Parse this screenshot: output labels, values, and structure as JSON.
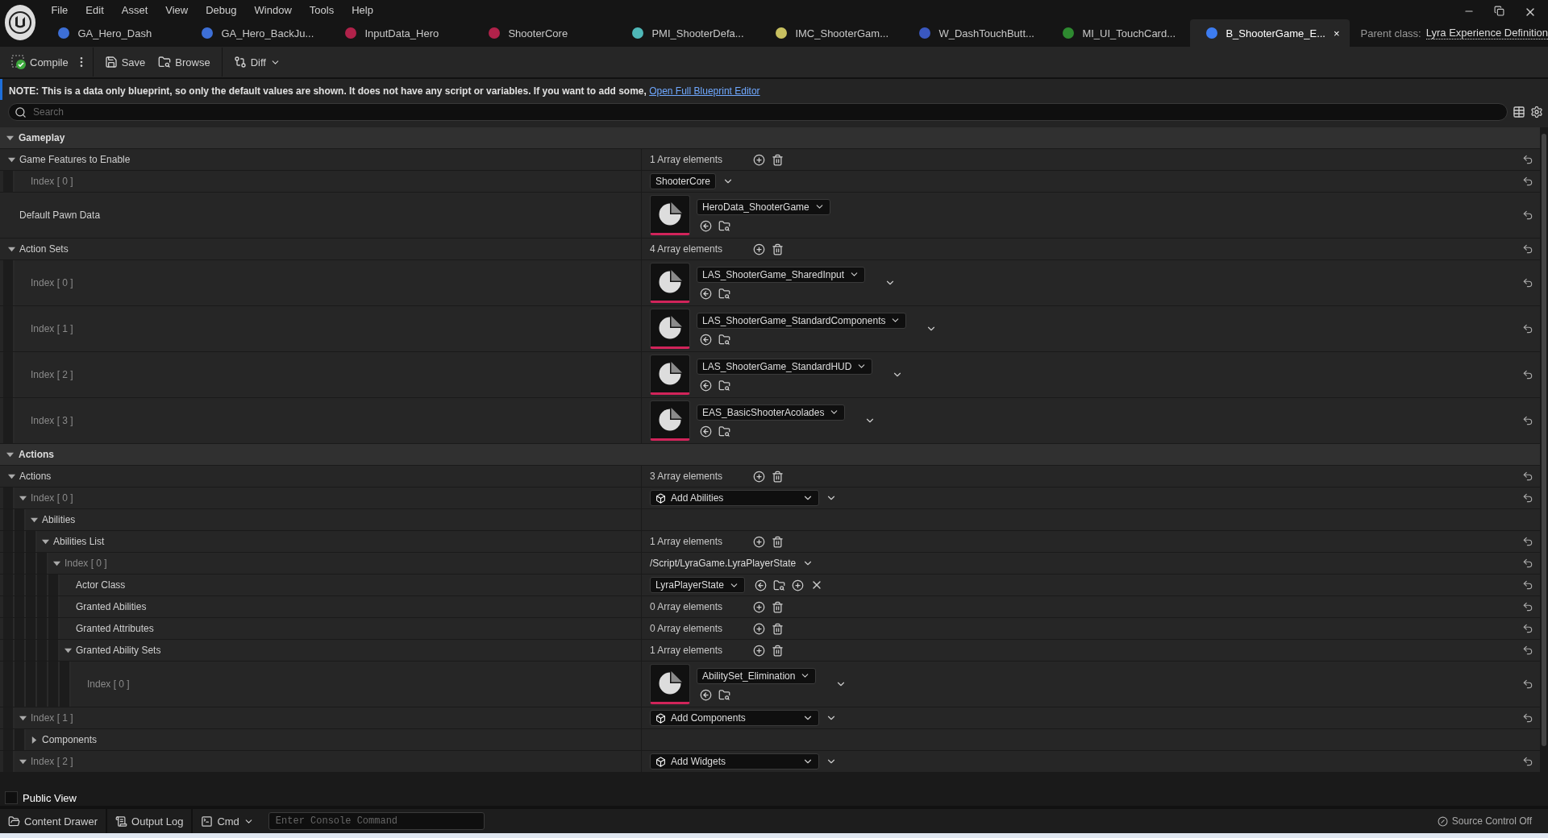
{
  "menu": [
    "File",
    "Edit",
    "Asset",
    "View",
    "Debug",
    "Window",
    "Tools",
    "Help"
  ],
  "tabs": [
    {
      "label": "GA_Hero_Dash",
      "color": "#3d6fd6",
      "selected": false
    },
    {
      "label": "GA_Hero_BackJu...",
      "color": "#3d6fd6",
      "selected": false
    },
    {
      "label": "InputData_Hero",
      "color": "#b0224a",
      "selected": false
    },
    {
      "label": "ShooterCore",
      "color": "#b0224a",
      "selected": false
    },
    {
      "label": "PMI_ShooterDefa...",
      "color": "#4fb8b8",
      "selected": false
    },
    {
      "label": "IMC_ShooterGam...",
      "color": "#c8c060",
      "selected": false
    },
    {
      "label": "W_DashTouchButt...",
      "color": "#3a58c0",
      "selected": false
    },
    {
      "label": "MI_UI_TouchCard...",
      "color": "#2e8a30",
      "selected": false
    },
    {
      "label": "B_ShooterGame_E...",
      "color": "#3d7cf0",
      "selected": true,
      "close": "×"
    }
  ],
  "parent_class": {
    "label": "Parent class:",
    "value": "Lyra Experience Definition"
  },
  "toolbar": [
    {
      "label": "Compile",
      "kind": "compile"
    },
    {
      "kind": "kebab"
    },
    {
      "label": "Save",
      "kind": "save"
    },
    {
      "label": "Browse",
      "kind": "browse"
    },
    {
      "label": "Diff",
      "kind": "diff"
    }
  ],
  "note": {
    "text": "NOTE: This is a data only blueprint, so only the default values are shown.  It does not have any script or variables.  If you want to add some, ",
    "link": "Open Full Blueprint Editor"
  },
  "search": {
    "placeholder": "Search"
  },
  "categories": [
    {
      "label": "Gameplay",
      "expanded": true,
      "rows": [
        {
          "label": "Game Features to Enable",
          "expanded": true,
          "reset": true,
          "value": {
            "kind": "array",
            "text": "1 Array elements"
          },
          "children": [
            {
              "label": "Index [ 0 ]",
              "index": true,
              "reset": true,
              "value": {
                "kind": "combo",
                "text": "ShooterCore"
              }
            }
          ]
        },
        {
          "label": "Default Pawn Data",
          "reset": true,
          "value": {
            "kind": "asset",
            "text": "HeroData_ShooterGame",
            "expander": false
          }
        },
        {
          "label": "Action Sets",
          "expanded": true,
          "reset": true,
          "value": {
            "kind": "array",
            "text": "4 Array elements"
          },
          "children": [
            {
              "label": "Index [ 0 ]",
              "index": true,
              "reset": true,
              "value": {
                "kind": "asset",
                "text": "LAS_ShooterGame_SharedInput",
                "expander": true
              }
            },
            {
              "label": "Index [ 1 ]",
              "index": true,
              "reset": true,
              "value": {
                "kind": "asset",
                "text": "LAS_ShooterGame_StandardComponents",
                "expander": true
              }
            },
            {
              "label": "Index [ 2 ]",
              "index": true,
              "reset": true,
              "value": {
                "kind": "asset",
                "text": "LAS_ShooterGame_StandardHUD",
                "expander": true
              }
            },
            {
              "label": "Index [ 3 ]",
              "index": true,
              "reset": true,
              "value": {
                "kind": "asset",
                "text": "EAS_BasicShooterAcolades",
                "expander": true
              }
            }
          ]
        }
      ]
    },
    {
      "label": "Actions",
      "expanded": true,
      "rows": [
        {
          "label": "Actions",
          "expanded": true,
          "reset": true,
          "value": {
            "kind": "array",
            "text": "3 Array elements"
          },
          "children": [
            {
              "label": "Index [ 0 ]",
              "index": true,
              "expanded": true,
              "reset": true,
              "value": {
                "kind": "instanced",
                "text": "Add Abilities"
              },
              "children": [
                {
                  "label": "Abilities",
                  "expanded": true,
                  "reset": false,
                  "children": [
                    {
                      "label": "Abilities List",
                      "expanded": true,
                      "reset": true,
                      "value": {
                        "kind": "array",
                        "text": "1 Array elements"
                      },
                      "children": [
                        {
                          "label": "Index [ 0 ]",
                          "index": true,
                          "expanded": true,
                          "reset": true,
                          "value": {
                            "kind": "path",
                            "text": "/Script/LyraGame.LyraPlayerState"
                          },
                          "children": [
                            {
                              "label": "Actor Class",
                              "reset": true,
                              "value": {
                                "kind": "class",
                                "text": "LyraPlayerState"
                              }
                            },
                            {
                              "label": "Granted Abilities",
                              "reset": true,
                              "value": {
                                "kind": "array",
                                "text": "0 Array elements"
                              }
                            },
                            {
                              "label": "Granted Attributes",
                              "reset": true,
                              "value": {
                                "kind": "array",
                                "text": "0 Array elements"
                              }
                            },
                            {
                              "label": "Granted Ability Sets",
                              "expanded": true,
                              "reset": true,
                              "value": {
                                "kind": "array",
                                "text": "1 Array elements"
                              },
                              "children": [
                                {
                                  "label": "Index [ 0 ]",
                                  "index": true,
                                  "reset": true,
                                  "value": {
                                    "kind": "asset",
                                    "text": "AbilitySet_Elimination",
                                    "expander": true
                                  }
                                }
                              ]
                            }
                          ]
                        }
                      ]
                    }
                  ]
                }
              ]
            },
            {
              "label": "Index [ 1 ]",
              "index": true,
              "expanded": true,
              "reset": true,
              "value": {
                "kind": "instanced",
                "text": "Add Components"
              },
              "children": [
                {
                  "label": "Components",
                  "expanded": false,
                  "reset": false
                }
              ]
            },
            {
              "label": "Index [ 2 ]",
              "index": true,
              "expanded": true,
              "reset": true,
              "value": {
                "kind": "instanced",
                "text": "Add Widgets"
              }
            }
          ]
        }
      ]
    }
  ],
  "public_view": {
    "label": "Public View",
    "checked": false
  },
  "status_bar": {
    "items": [
      {
        "label": "Content Drawer",
        "kind": "drawer"
      },
      {
        "label": "Output Log",
        "kind": "log"
      },
      {
        "label": "Cmd",
        "kind": "cmd"
      }
    ],
    "console_placeholder": "Enter Console Command",
    "source_control": "Source Control Off"
  }
}
